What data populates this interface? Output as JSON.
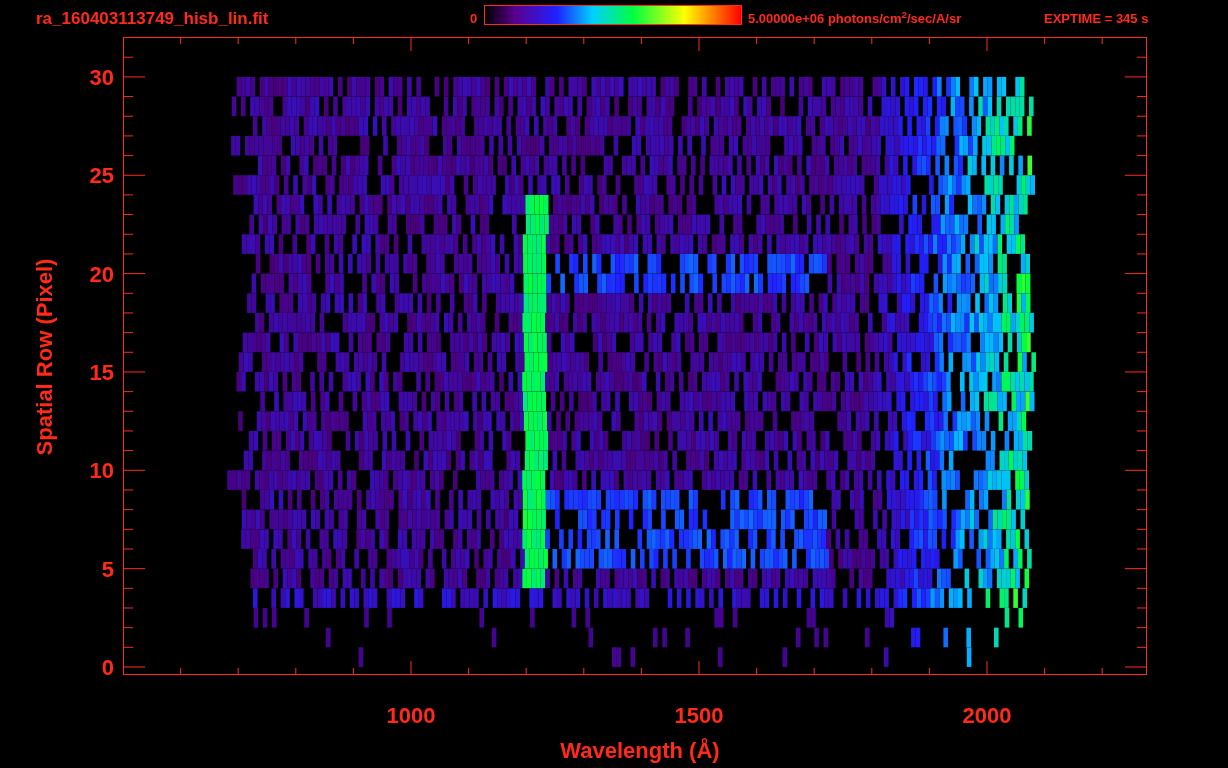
{
  "title": "ra_160403113749_hisb_lin.fit",
  "colorbar": {
    "min_label": "0",
    "max_label": "5.00000e+06 photons/cm$^{2}$/sec/A/sr"
  },
  "exposure": "EXPTIME = 345 s",
  "plot": {
    "ylabel": "Spatial Row (Pixel)",
    "xlabel": "Wavelength (Å)",
    "yticks": [
      "30",
      "25",
      "20",
      "15",
      "10",
      "5",
      "0"
    ],
    "xticks": [
      "1000",
      "1500",
      "2000"
    ]
  }
}
